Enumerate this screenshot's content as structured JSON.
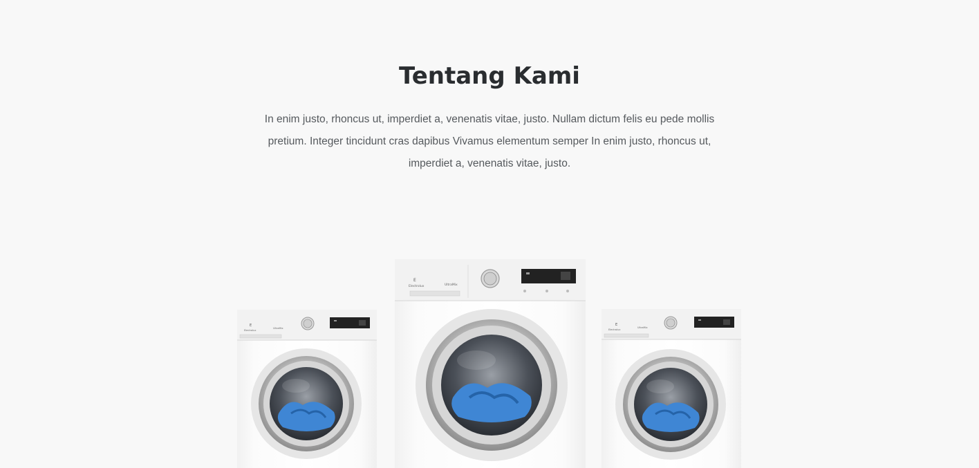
{
  "about": {
    "title": "Tentang Kami",
    "paragraph": "In enim justo, rhoncus ut, imperdiet a, venenatis vitae, justo. Nullam dictum felis eu pede mollis pretium. Integer tincidunt cras dapibus Vivamus elementum semper In enim justo, rhoncus ut, imperdiet a, venenatis vitae, justo."
  },
  "colors": {
    "background": "#f8f8f8",
    "title": "#2a2d30",
    "text": "#55595d",
    "laundry_blue": "#3f86d4"
  },
  "illustration": {
    "machines": [
      {
        "icon": "washing-machine-icon",
        "position": "left"
      },
      {
        "icon": "washing-machine-icon",
        "position": "center"
      },
      {
        "icon": "washing-machine-icon",
        "position": "right"
      }
    ]
  }
}
